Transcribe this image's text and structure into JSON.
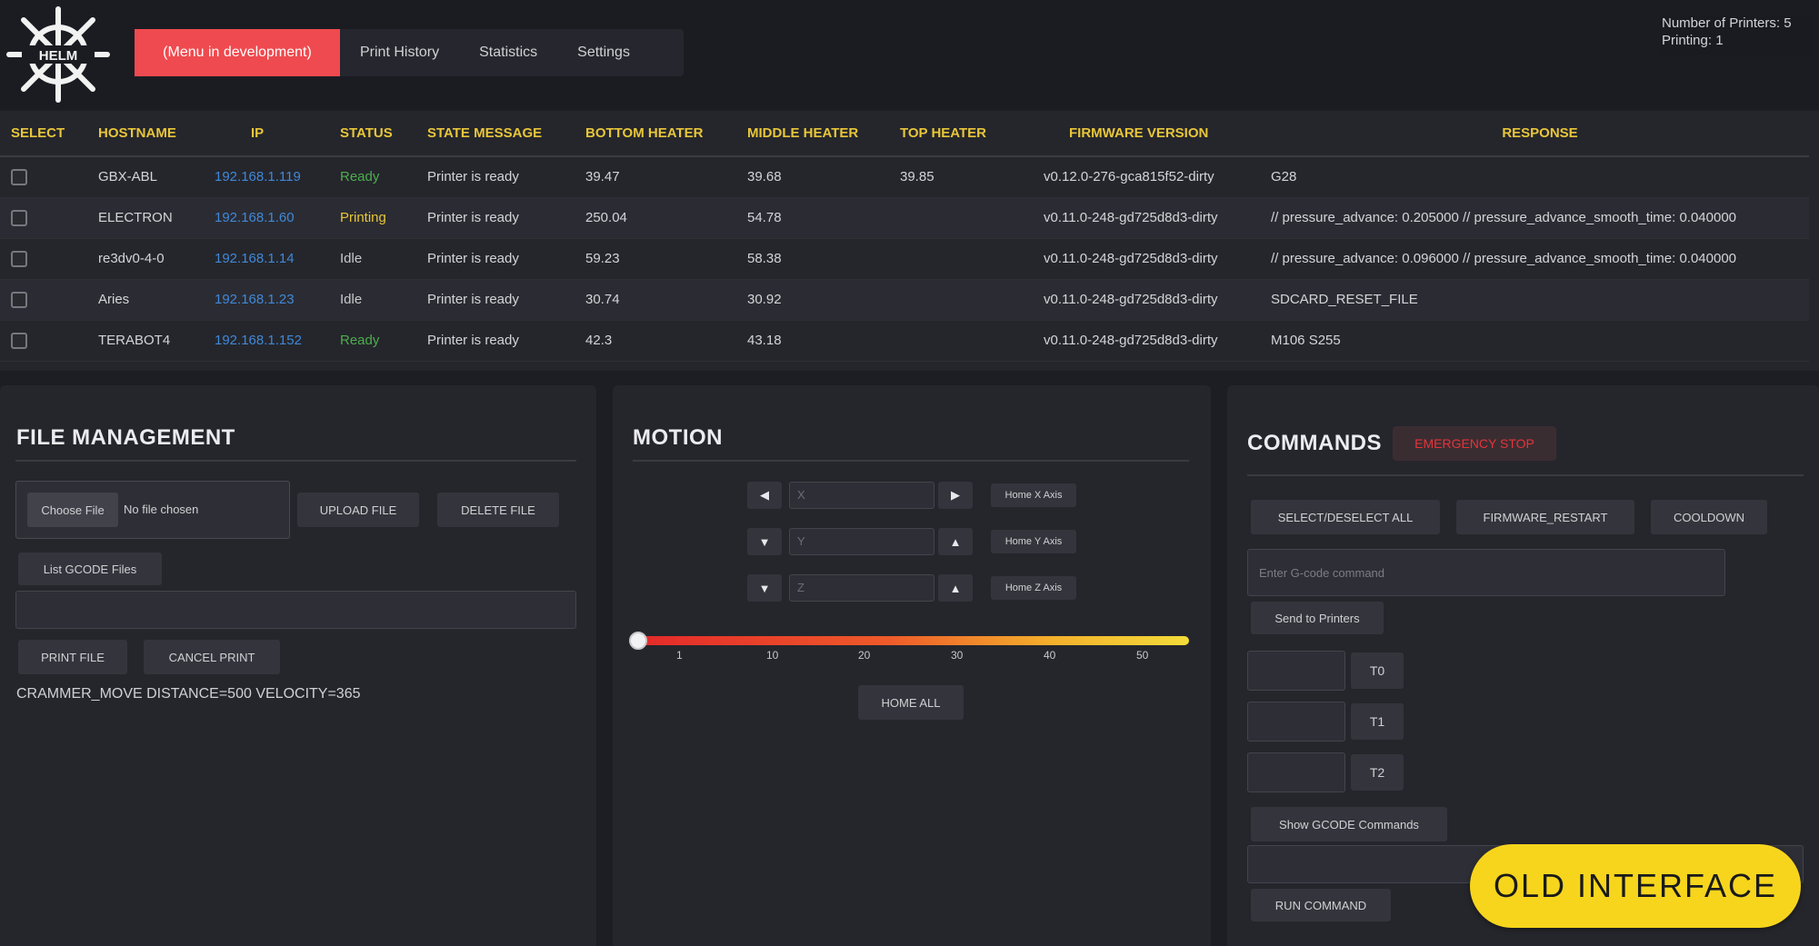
{
  "header": {
    "logo_text": "HELM",
    "nav": [
      {
        "label": "(Menu in development)",
        "active": true
      },
      {
        "label": "Print History",
        "active": false
      },
      {
        "label": "Statistics",
        "active": false
      },
      {
        "label": "Settings",
        "active": false
      }
    ],
    "counters": {
      "printers": "Number of Printers: 5",
      "printing": "Printing: 1"
    }
  },
  "table": {
    "columns": [
      "SELECT",
      "HOSTNAME",
      "IP",
      "STATUS",
      "STATE MESSAGE",
      "BOTTOM HEATER",
      "MIDDLE HEATER",
      "TOP HEATER",
      "FIRMWARE VERSION",
      "RESPONSE"
    ],
    "rows": [
      {
        "hostname": "GBX-ABL",
        "ip": "192.168.1.119",
        "status": "Ready",
        "message": "Printer is ready",
        "bottom": "39.47",
        "middle": "39.68",
        "top": "39.85",
        "firmware": "v0.12.0-276-gca815f52-dirty",
        "response": "G28"
      },
      {
        "hostname": "ELECTRON",
        "ip": "192.168.1.60",
        "status": "Printing",
        "message": "Printer is ready",
        "bottom": "250.04",
        "middle": "54.78",
        "top": "",
        "firmware": "v0.11.0-248-gd725d8d3-dirty",
        "response": "// pressure_advance: 0.205000 // pressure_advance_smooth_time: 0.040000"
      },
      {
        "hostname": "re3dv0-4-0",
        "ip": "192.168.1.14",
        "status": "Idle",
        "message": "Printer is ready",
        "bottom": "59.23",
        "middle": "58.38",
        "top": "",
        "firmware": "v0.11.0-248-gd725d8d3-dirty",
        "response": "// pressure_advance: 0.096000 // pressure_advance_smooth_time: 0.040000"
      },
      {
        "hostname": "Aries",
        "ip": "192.168.1.23",
        "status": "Idle",
        "message": "Printer is ready",
        "bottom": "30.74",
        "middle": "30.92",
        "top": "",
        "firmware": "v0.11.0-248-gd725d8d3-dirty",
        "response": "SDCARD_RESET_FILE"
      },
      {
        "hostname": "TERABOT4",
        "ip": "192.168.1.152",
        "status": "Ready",
        "message": "Printer is ready",
        "bottom": "42.3",
        "middle": "43.18",
        "top": "",
        "firmware": "v0.11.0-248-gd725d8d3-dirty",
        "response": "M106 S255"
      }
    ]
  },
  "file_management": {
    "title": "FILE MANAGEMENT",
    "choose_label": "Choose File",
    "no_file": "No file chosen",
    "upload_label": "UPLOAD FILE",
    "delete_label": "DELETE FILE",
    "list_label": "List GCODE Files",
    "print_label": "PRINT FILE",
    "cancel_label": "CANCEL PRINT",
    "last_command": "CRAMMER_MOVE DISTANCE=500 VELOCITY=365"
  },
  "motion": {
    "title": "MOTION",
    "axes": [
      {
        "placeholder": "X",
        "home": "Home X Axis",
        "minus": "◀",
        "plus": "▶"
      },
      {
        "placeholder": "Y",
        "home": "Home Y Axis",
        "minus": "▼",
        "plus": "▲"
      },
      {
        "placeholder": "Z",
        "home": "Home Z Axis",
        "minus": "▼",
        "plus": "▲"
      }
    ],
    "slider_value": 0,
    "ticks": [
      "1",
      "10",
      "20",
      "30",
      "40",
      "50"
    ],
    "home_all": "HOME ALL"
  },
  "commands": {
    "title": "COMMANDS",
    "emergency_stop": "EMERGENCY STOP",
    "select_all": "SELECT/DESELECT ALL",
    "firmware_restart": "FIRMWARE_RESTART",
    "cooldown": "COOLDOWN",
    "gcode_placeholder": "Enter G-code command",
    "send_label": "Send to Printers",
    "tools": [
      "T0",
      "T1",
      "T2"
    ],
    "show_gcode": "Show GCODE Commands",
    "run_command": "RUN COMMAND"
  },
  "badge": "OLD INTERFACE",
  "colors": {
    "accent_red": "#ef4a4f",
    "header_yellow": "#e8c63a",
    "ip_blue": "#3f88d8",
    "ready_green": "#4cae4c",
    "badge_yellow": "#f7d51d"
  }
}
